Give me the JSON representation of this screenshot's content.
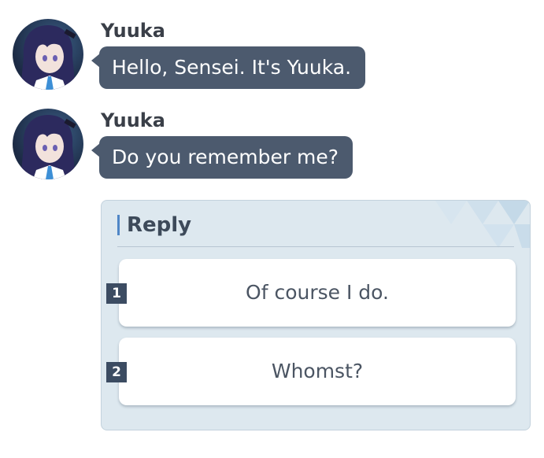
{
  "messages": [
    {
      "sender": "Yuuka",
      "text": "Hello, Sensei. It's Yuuka."
    },
    {
      "sender": "Yuuka",
      "text": "Do you remember me?"
    }
  ],
  "reply": {
    "title": "Reply",
    "options": [
      {
        "number": "1",
        "text": "Of course I do."
      },
      {
        "number": "2",
        "text": "Whomst?"
      }
    ]
  },
  "colors": {
    "bubble": "#4c5a6e",
    "panel": "#dde8ef",
    "accent": "#4f86c6",
    "number_badge": "#3c4c62"
  }
}
